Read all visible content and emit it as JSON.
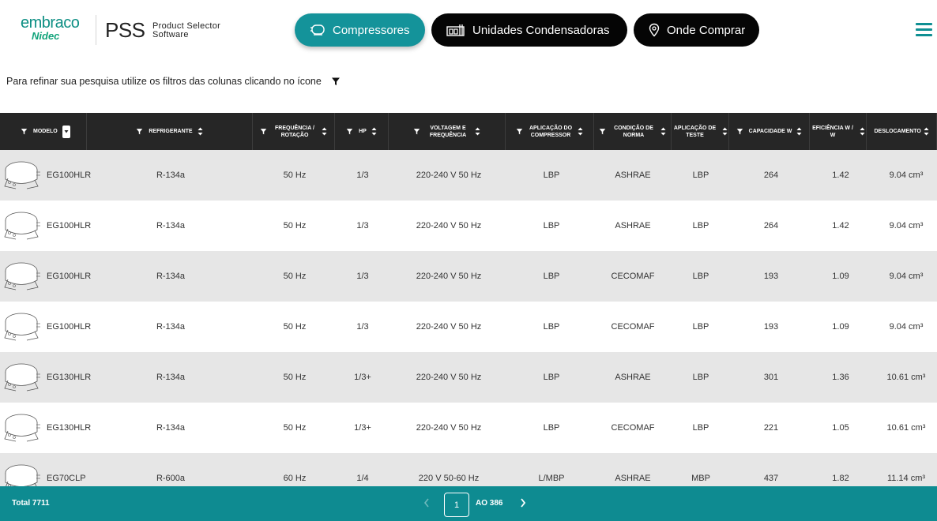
{
  "header": {
    "logo_top": "embraco",
    "logo_bottom": "Nidec",
    "app_abbr": "PSS",
    "app_name_line1": "Product Selector",
    "app_name_line2": "Software",
    "nav": [
      {
        "label": "Compressores",
        "icon": "compressor-icon",
        "active": true
      },
      {
        "label": "Unidades Condensadoras",
        "icon": "condensing-unit-icon",
        "active": false
      },
      {
        "label": "Onde Comprar",
        "icon": "location-pin-icon",
        "active": false
      }
    ],
    "menu_icon": "hamburger-menu-icon"
  },
  "hint": "Para refinar sua pesquisa utilize os filtros das colunas clicando no ícone",
  "columns": [
    {
      "key": "modelo",
      "label": "MODELO",
      "sort": "dropdown"
    },
    {
      "key": "refrigerante",
      "label": "REFRIGERANTE"
    },
    {
      "key": "frequencia",
      "label": "FREQUÊNCIA / ROTAÇÃO"
    },
    {
      "key": "hp",
      "label": "HP"
    },
    {
      "key": "voltagem",
      "label": "VOLTAGEM E FREQUÊNCIA"
    },
    {
      "key": "aplicacao",
      "label": "APLICAÇÃO DO COMPRESSOR"
    },
    {
      "key": "condicao",
      "label": "CONDIÇÃO DE NORMA"
    },
    {
      "key": "teste",
      "label": "APLICAÇÃO DE TESTE"
    },
    {
      "key": "capacidade",
      "label": "CAPACIDADE W"
    },
    {
      "key": "eficiencia",
      "label": "EFICIÊNCIA W / W"
    },
    {
      "key": "deslocamento",
      "label": "DESLOCAMENTO"
    }
  ],
  "rows": [
    [
      "EG100HLR",
      "R-134a",
      "50 Hz",
      "1/3",
      "220-240 V 50 Hz",
      "LBP",
      "ASHRAE",
      "LBP",
      "264",
      "1.42",
      "9.04 cm³"
    ],
    [
      "EG100HLR",
      "R-134a",
      "50 Hz",
      "1/3",
      "220-240 V 50 Hz",
      "LBP",
      "ASHRAE",
      "LBP",
      "264",
      "1.42",
      "9.04 cm³"
    ],
    [
      "EG100HLR",
      "R-134a",
      "50 Hz",
      "1/3",
      "220-240 V 50 Hz",
      "LBP",
      "CECOMAF",
      "LBP",
      "193",
      "1.09",
      "9.04 cm³"
    ],
    [
      "EG100HLR",
      "R-134a",
      "50 Hz",
      "1/3",
      "220-240 V 50 Hz",
      "LBP",
      "CECOMAF",
      "LBP",
      "193",
      "1.09",
      "9.04 cm³"
    ],
    [
      "EG130HLR",
      "R-134a",
      "50 Hz",
      "1/3+",
      "220-240 V 50 Hz",
      "LBP",
      "ASHRAE",
      "LBP",
      "301",
      "1.36",
      "10.61 cm³"
    ],
    [
      "EG130HLR",
      "R-134a",
      "50 Hz",
      "1/3+",
      "220-240 V 50 Hz",
      "LBP",
      "CECOMAF",
      "LBP",
      "221",
      "1.05",
      "10.61 cm³"
    ],
    [
      "EG70CLP",
      "R-600a",
      "60 Hz",
      "1/4",
      "220 V 50-60 Hz",
      "L/MBP",
      "ASHRAE",
      "MBP",
      "437",
      "1.82",
      "11.14 cm³"
    ]
  ],
  "footer": {
    "total": "Total 7711",
    "prev_icon": "chevron-left-icon",
    "page": "1",
    "of_pages": "AO 386",
    "next_icon": "chevron-right-icon"
  },
  "colors": {
    "accent": "#14939a",
    "footer": "#0e8b91",
    "header_row": "#262626",
    "row_alt": "#e6e6e6",
    "brand": "#0e8f84"
  }
}
